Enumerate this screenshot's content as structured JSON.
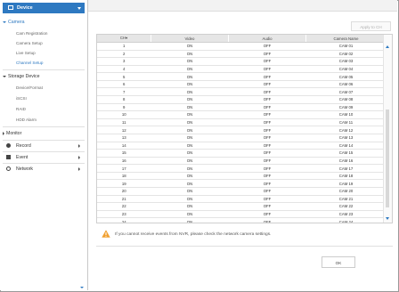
{
  "sidebar": {
    "device_label": "Device",
    "camera_group": "Camera",
    "camera_items": [
      "Cam Registration",
      "Camera Setup",
      "Live Setup",
      "Channel Setup"
    ],
    "storage_group": "Storage Device",
    "storage_items": [
      "Device/Format",
      "iSCSI",
      "RAID",
      "HDD Alarm"
    ],
    "monitor_group": "Monitor",
    "menu": [
      {
        "label": "Record",
        "icon": "record-icon"
      },
      {
        "label": "Event",
        "icon": "event-icon"
      },
      {
        "label": "Network",
        "icon": "network-icon"
      }
    ]
  },
  "toolbar": {
    "apply_label": "Apply to CH"
  },
  "table": {
    "headers": [
      "CH▾",
      "Video",
      "Audio",
      "Camera Name"
    ],
    "rows": [
      [
        "1",
        "ON",
        "OFF",
        "CAM 01"
      ],
      [
        "2",
        "ON",
        "OFF",
        "CAM 02"
      ],
      [
        "3",
        "ON",
        "OFF",
        "CAM 03"
      ],
      [
        "4",
        "ON",
        "OFF",
        "CAM 04"
      ],
      [
        "5",
        "ON",
        "OFF",
        "CAM 05"
      ],
      [
        "6",
        "ON",
        "OFF",
        "CAM 06"
      ],
      [
        "7",
        "ON",
        "OFF",
        "CAM 07"
      ],
      [
        "8",
        "ON",
        "OFF",
        "CAM 08"
      ],
      [
        "9",
        "ON",
        "OFF",
        "CAM 09"
      ],
      [
        "10",
        "ON",
        "OFF",
        "CAM 10"
      ],
      [
        "11",
        "ON",
        "OFF",
        "CAM 11"
      ],
      [
        "12",
        "ON",
        "OFF",
        "CAM 12"
      ],
      [
        "13",
        "ON",
        "OFF",
        "CAM 13"
      ],
      [
        "14",
        "ON",
        "OFF",
        "CAM 14"
      ],
      [
        "15",
        "ON",
        "OFF",
        "CAM 15"
      ],
      [
        "16",
        "ON",
        "OFF",
        "CAM 16"
      ],
      [
        "17",
        "ON",
        "OFF",
        "CAM 17"
      ],
      [
        "18",
        "ON",
        "OFF",
        "CAM 18"
      ],
      [
        "19",
        "ON",
        "OFF",
        "CAM 19"
      ],
      [
        "20",
        "ON",
        "OFF",
        "CAM 20"
      ],
      [
        "21",
        "ON",
        "OFF",
        "CAM 21"
      ],
      [
        "22",
        "ON",
        "OFF",
        "CAM 22"
      ],
      [
        "23",
        "ON",
        "OFF",
        "CAM 23"
      ],
      [
        "24",
        "ON",
        "OFF",
        "CAM 24"
      ]
    ]
  },
  "notice": {
    "text": "If you cannot receive events from NVR, please check the network camera settings.",
    "icon": "warning-icon"
  },
  "footer": {
    "ok_label": "OK"
  },
  "colors": {
    "accent": "#2e79c1",
    "warning": "#f0a030"
  }
}
